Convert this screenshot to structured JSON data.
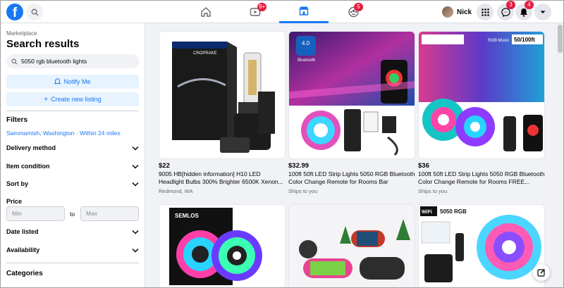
{
  "nav": {
    "logo_letter": "f",
    "watch_badge": "9+",
    "groups_badge": "5",
    "profile_name": "Nick",
    "messenger_badge": "3",
    "notifications_badge": "4"
  },
  "sidebar": {
    "breadcrumb": "Marketplace",
    "title": "Search results",
    "search_value": "5050 rgb bluetooth lights",
    "notify_label": "Notify Me",
    "create_label": "Create new listing",
    "filters_heading": "Filters",
    "location": "Sammamish, Washington · Within 24 miles",
    "filters": [
      "Delivery method",
      "Item condition",
      "Sort by"
    ],
    "price_label": "Price",
    "price_min_placeholder": "Min",
    "price_to": "to",
    "price_max_placeholder": "Max",
    "filters2": [
      "Date listed",
      "Availability"
    ],
    "categories_heading": "Categories"
  },
  "listings": [
    {
      "price": "$22",
      "title": "9005 HB[hidden information] H10 LED Headlight Bulbs 300% Brighter 6500K Xenon...",
      "location": "Redmond, WA"
    },
    {
      "price": "$32.99",
      "title": "100ft 50ft LED Strip Lights 5050 RGB Bluetooth Color Change Remote for Rooms Bar",
      "location": "Ships to you"
    },
    {
      "price": "$36",
      "title": "100ft 50ft LED Strip Lights 5050 RGB Bluetooth Color Change Remote for Rooms FREE...",
      "location": "Ships to you"
    }
  ],
  "image_text": {
    "box_brand": "CROPRAKE",
    "bt_label": "Bluetooth",
    "bt_4": "4.0",
    "rgb_music": "RGB Music",
    "length": "50/100ft",
    "semlos": "SEMLOS",
    "wifi": "WiFi",
    "rgb5050": "5050 RGB"
  }
}
